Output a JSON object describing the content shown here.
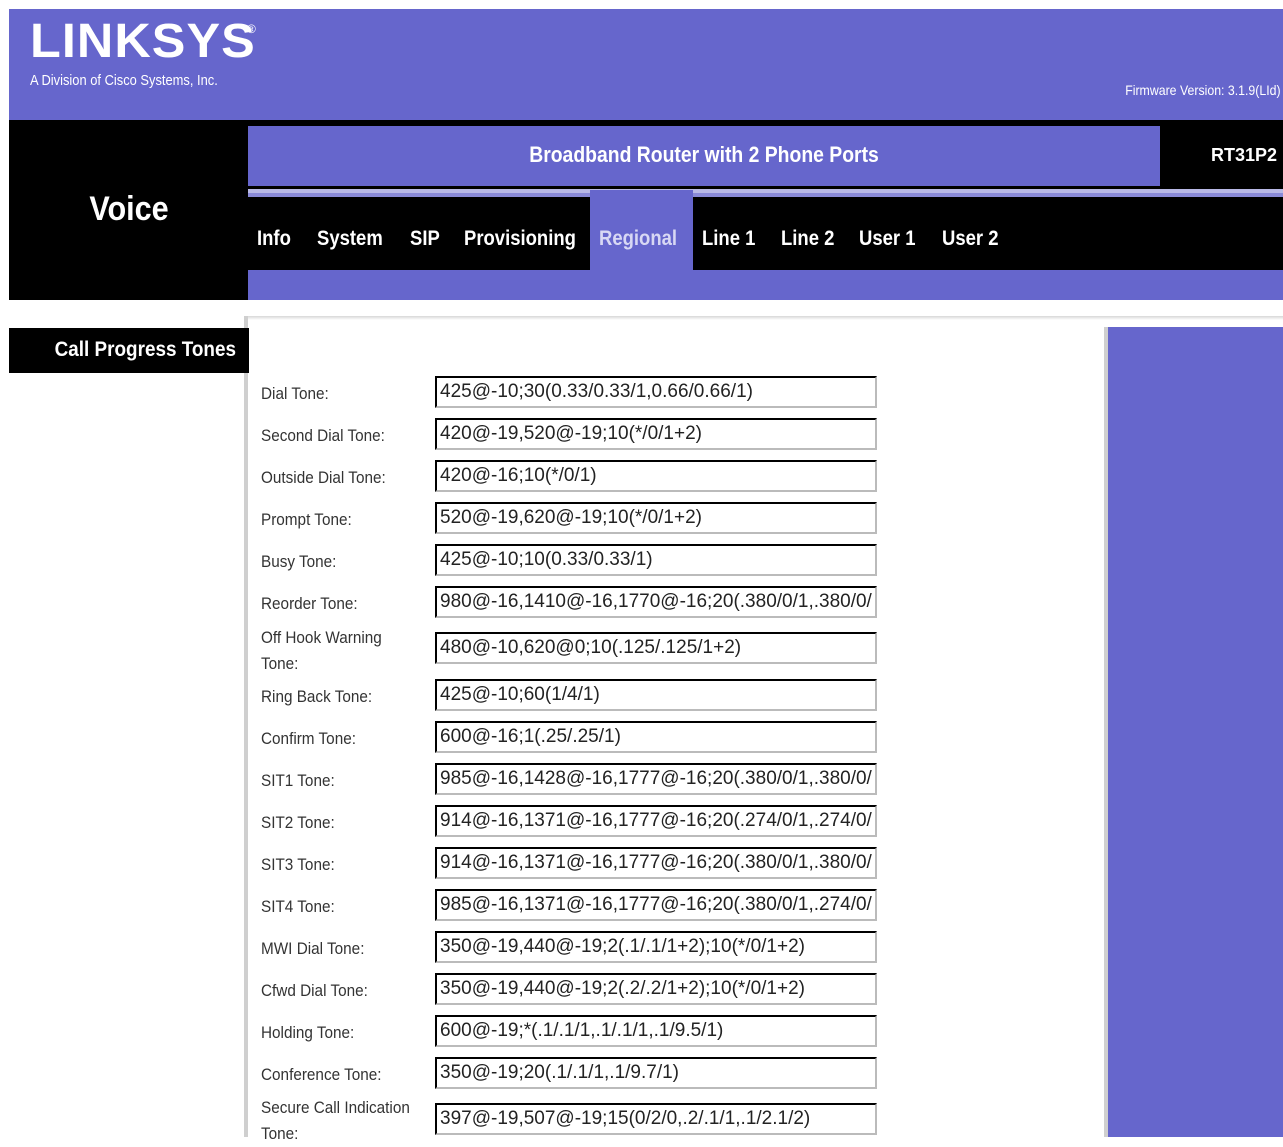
{
  "header": {
    "logo": "LINKSYS",
    "tagline": "A Division of Cisco Systems, Inc.",
    "firmware": "Firmware Version: 3.1.9(LId)"
  },
  "product": {
    "name": "Broadband Router with 2 Phone Ports",
    "model": "RT31P2"
  },
  "section": "Voice",
  "tabs": [
    "Info",
    "System",
    "SIP",
    "Provisioning",
    "Regional",
    "Line 1",
    "Line 2",
    "User 1",
    "User 2"
  ],
  "active_tab": "Regional",
  "sidebar": {
    "label": "Call Progress Tones"
  },
  "colors": {
    "brand": "#6666cc",
    "band": "#000000"
  },
  "fields": [
    {
      "label": "Dial Tone:",
      "value": "425@-10;30(0.33/0.33/1,0.66/0.66/1)"
    },
    {
      "label": "Second Dial Tone:",
      "value": "420@-19,520@-19;10(*/0/1+2)"
    },
    {
      "label": "Outside Dial Tone:",
      "value": "420@-16;10(*/0/1)"
    },
    {
      "label": "Prompt Tone:",
      "value": "520@-19,620@-19;10(*/0/1+2)"
    },
    {
      "label": "Busy Tone:",
      "value": "425@-10;10(0.33/0.33/1)"
    },
    {
      "label": "Reorder Tone:",
      "value": "980@-16,1410@-16,1770@-16;20(.380/0/1,.380/0/"
    },
    {
      "label": "Off Hook Warning Tone:",
      "value": "480@-10,620@0;10(.125/.125/1+2)"
    },
    {
      "label": "Ring Back Tone:",
      "value": "425@-10;60(1/4/1)"
    },
    {
      "label": "Confirm Tone:",
      "value": "600@-16;1(.25/.25/1)"
    },
    {
      "label": "SIT1 Tone:",
      "value": "985@-16,1428@-16,1777@-16;20(.380/0/1,.380/0/"
    },
    {
      "label": "SIT2 Tone:",
      "value": "914@-16,1371@-16,1777@-16;20(.274/0/1,.274/0/"
    },
    {
      "label": "SIT3 Tone:",
      "value": "914@-16,1371@-16,1777@-16;20(.380/0/1,.380/0/"
    },
    {
      "label": "SIT4 Tone:",
      "value": "985@-16,1371@-16,1777@-16;20(.380/0/1,.274/0/"
    },
    {
      "label": "MWI Dial Tone:",
      "value": "350@-19,440@-19;2(.1/.1/1+2);10(*/0/1+2)"
    },
    {
      "label": "Cfwd Dial Tone:",
      "value": "350@-19,440@-19;2(.2/.2/1+2);10(*/0/1+2)"
    },
    {
      "label": "Holding Tone:",
      "value": "600@-19;*(.1/.1/1,.1/.1/1,.1/9.5/1)"
    },
    {
      "label": "Conference Tone:",
      "value": "350@-19;20(.1/.1/1,.1/9.7/1)"
    },
    {
      "label": "Secure Call Indication Tone:",
      "value": "397@-19,507@-19;15(0/2/0,.2/.1/1,.1/2.1/2)"
    }
  ]
}
